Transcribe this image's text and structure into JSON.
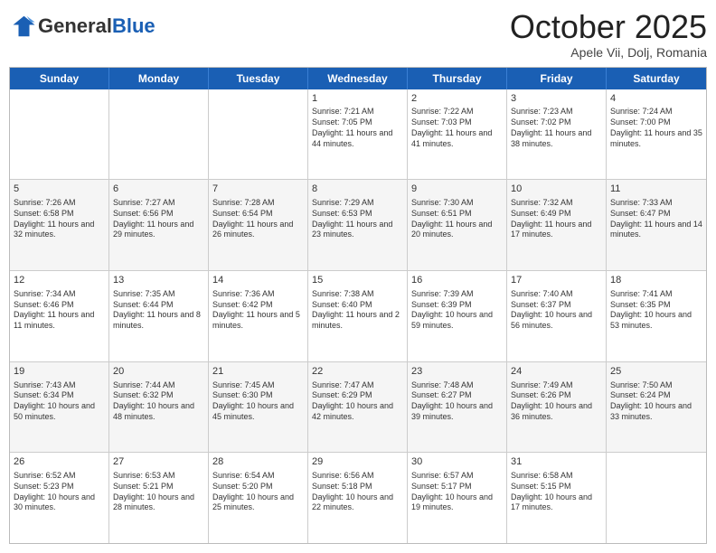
{
  "header": {
    "logo_general": "General",
    "logo_blue": "Blue",
    "month_title": "October 2025",
    "subtitle": "Apele Vii, Dolj, Romania"
  },
  "days_of_week": [
    "Sunday",
    "Monday",
    "Tuesday",
    "Wednesday",
    "Thursday",
    "Friday",
    "Saturday"
  ],
  "rows": [
    {
      "alt": false,
      "cells": [
        {
          "day": "",
          "info": ""
        },
        {
          "day": "",
          "info": ""
        },
        {
          "day": "",
          "info": ""
        },
        {
          "day": "1",
          "info": "Sunrise: 7:21 AM\nSunset: 7:05 PM\nDaylight: 11 hours and 44 minutes."
        },
        {
          "day": "2",
          "info": "Sunrise: 7:22 AM\nSunset: 7:03 PM\nDaylight: 11 hours and 41 minutes."
        },
        {
          "day": "3",
          "info": "Sunrise: 7:23 AM\nSunset: 7:02 PM\nDaylight: 11 hours and 38 minutes."
        },
        {
          "day": "4",
          "info": "Sunrise: 7:24 AM\nSunset: 7:00 PM\nDaylight: 11 hours and 35 minutes."
        }
      ]
    },
    {
      "alt": true,
      "cells": [
        {
          "day": "5",
          "info": "Sunrise: 7:26 AM\nSunset: 6:58 PM\nDaylight: 11 hours and 32 minutes."
        },
        {
          "day": "6",
          "info": "Sunrise: 7:27 AM\nSunset: 6:56 PM\nDaylight: 11 hours and 29 minutes."
        },
        {
          "day": "7",
          "info": "Sunrise: 7:28 AM\nSunset: 6:54 PM\nDaylight: 11 hours and 26 minutes."
        },
        {
          "day": "8",
          "info": "Sunrise: 7:29 AM\nSunset: 6:53 PM\nDaylight: 11 hours and 23 minutes."
        },
        {
          "day": "9",
          "info": "Sunrise: 7:30 AM\nSunset: 6:51 PM\nDaylight: 11 hours and 20 minutes."
        },
        {
          "day": "10",
          "info": "Sunrise: 7:32 AM\nSunset: 6:49 PM\nDaylight: 11 hours and 17 minutes."
        },
        {
          "day": "11",
          "info": "Sunrise: 7:33 AM\nSunset: 6:47 PM\nDaylight: 11 hours and 14 minutes."
        }
      ]
    },
    {
      "alt": false,
      "cells": [
        {
          "day": "12",
          "info": "Sunrise: 7:34 AM\nSunset: 6:46 PM\nDaylight: 11 hours and 11 minutes."
        },
        {
          "day": "13",
          "info": "Sunrise: 7:35 AM\nSunset: 6:44 PM\nDaylight: 11 hours and 8 minutes."
        },
        {
          "day": "14",
          "info": "Sunrise: 7:36 AM\nSunset: 6:42 PM\nDaylight: 11 hours and 5 minutes."
        },
        {
          "day": "15",
          "info": "Sunrise: 7:38 AM\nSunset: 6:40 PM\nDaylight: 11 hours and 2 minutes."
        },
        {
          "day": "16",
          "info": "Sunrise: 7:39 AM\nSunset: 6:39 PM\nDaylight: 10 hours and 59 minutes."
        },
        {
          "day": "17",
          "info": "Sunrise: 7:40 AM\nSunset: 6:37 PM\nDaylight: 10 hours and 56 minutes."
        },
        {
          "day": "18",
          "info": "Sunrise: 7:41 AM\nSunset: 6:35 PM\nDaylight: 10 hours and 53 minutes."
        }
      ]
    },
    {
      "alt": true,
      "cells": [
        {
          "day": "19",
          "info": "Sunrise: 7:43 AM\nSunset: 6:34 PM\nDaylight: 10 hours and 50 minutes."
        },
        {
          "day": "20",
          "info": "Sunrise: 7:44 AM\nSunset: 6:32 PM\nDaylight: 10 hours and 48 minutes."
        },
        {
          "day": "21",
          "info": "Sunrise: 7:45 AM\nSunset: 6:30 PM\nDaylight: 10 hours and 45 minutes."
        },
        {
          "day": "22",
          "info": "Sunrise: 7:47 AM\nSunset: 6:29 PM\nDaylight: 10 hours and 42 minutes."
        },
        {
          "day": "23",
          "info": "Sunrise: 7:48 AM\nSunset: 6:27 PM\nDaylight: 10 hours and 39 minutes."
        },
        {
          "day": "24",
          "info": "Sunrise: 7:49 AM\nSunset: 6:26 PM\nDaylight: 10 hours and 36 minutes."
        },
        {
          "day": "25",
          "info": "Sunrise: 7:50 AM\nSunset: 6:24 PM\nDaylight: 10 hours and 33 minutes."
        }
      ]
    },
    {
      "alt": false,
      "cells": [
        {
          "day": "26",
          "info": "Sunrise: 6:52 AM\nSunset: 5:23 PM\nDaylight: 10 hours and 30 minutes."
        },
        {
          "day": "27",
          "info": "Sunrise: 6:53 AM\nSunset: 5:21 PM\nDaylight: 10 hours and 28 minutes."
        },
        {
          "day": "28",
          "info": "Sunrise: 6:54 AM\nSunset: 5:20 PM\nDaylight: 10 hours and 25 minutes."
        },
        {
          "day": "29",
          "info": "Sunrise: 6:56 AM\nSunset: 5:18 PM\nDaylight: 10 hours and 22 minutes."
        },
        {
          "day": "30",
          "info": "Sunrise: 6:57 AM\nSunset: 5:17 PM\nDaylight: 10 hours and 19 minutes."
        },
        {
          "day": "31",
          "info": "Sunrise: 6:58 AM\nSunset: 5:15 PM\nDaylight: 10 hours and 17 minutes."
        },
        {
          "day": "",
          "info": ""
        }
      ]
    }
  ]
}
